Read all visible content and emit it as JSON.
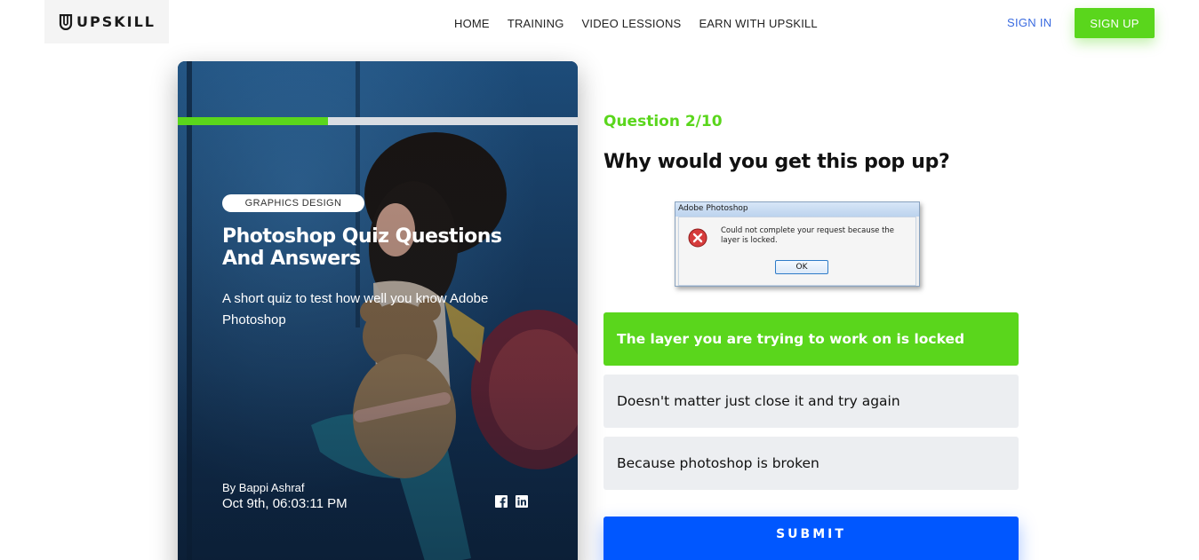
{
  "header": {
    "logo_text": "UPSKILL",
    "nav": [
      "HOME",
      "TRAINING",
      "VIDEO LESSIONS",
      "EARN WITH UPSKILL"
    ],
    "sign_in": "SIGN IN",
    "sign_up": "SIGN UP"
  },
  "card": {
    "progress_fraction": 0.375,
    "category": "GRAPHICS DESIGN",
    "title": "Photoshop Quiz Questions And Answers",
    "description": "A short quiz to test how well you know Adobe Photoshop",
    "author": "By Bappi Ashraf",
    "date": "Oct 9th, 06:03:11 PM",
    "social_icons": [
      "facebook-icon",
      "linkedin-icon"
    ]
  },
  "quiz": {
    "counter": "Question 2/10",
    "question": "Why would you get this pop up?",
    "dialog": {
      "title": "Adobe Photoshop",
      "message": "Could not complete your request because the layer is locked.",
      "ok": "OK",
      "icon": "error-icon"
    },
    "options": [
      {
        "label": "The layer you are trying to work on is locked",
        "selected": true
      },
      {
        "label": "Doesn't matter just close it and try again",
        "selected": false
      },
      {
        "label": "Because photoshop is broken",
        "selected": false
      }
    ],
    "submit": "SUBMIT"
  },
  "colors": {
    "accent_green": "#5ad61c",
    "primary_blue": "#0057ff",
    "link_blue": "#3a6be0",
    "option_bg": "#eceef1"
  }
}
